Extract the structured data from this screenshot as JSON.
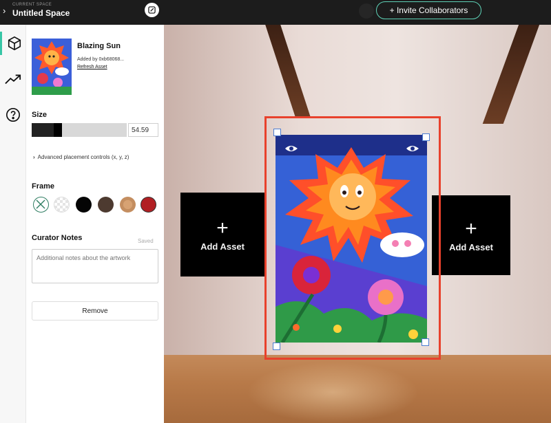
{
  "topbar": {
    "space_kicker": "CURRENT SPACE",
    "space_name": "Untitled Space",
    "invite_label": "+ Invite Collaborators"
  },
  "rail": {
    "items": [
      {
        "icon": "cube-icon",
        "active": true
      },
      {
        "icon": "trend-up-icon",
        "active": false
      },
      {
        "icon": "help-icon",
        "active": false
      }
    ]
  },
  "panel": {
    "asset": {
      "title": "Blazing Sun",
      "added_by": "Added by 0xb68068...",
      "refresh": "Refresh Asset"
    },
    "size": {
      "label": "Size",
      "value": "54.59",
      "fraction": 0.25
    },
    "advanced": "Advanced placement controls (x, y, z)",
    "frame": {
      "label": "Frame",
      "options": [
        "none",
        "clear",
        "black",
        "dark-brown",
        "tan",
        "red"
      ]
    },
    "curator": {
      "label": "Curator Notes",
      "saved": "Saved",
      "placeholder": "Additional notes about the artwork"
    },
    "remove_label": "Remove"
  },
  "scene": {
    "add_left": {
      "plus": "+",
      "label": "Add Asset"
    },
    "add_right": {
      "plus": "+",
      "label": "Add Asset"
    }
  },
  "colors": {
    "accent": "#5fd3b8",
    "selection": "#e8412c",
    "handle_border": "#4a7bd1"
  }
}
